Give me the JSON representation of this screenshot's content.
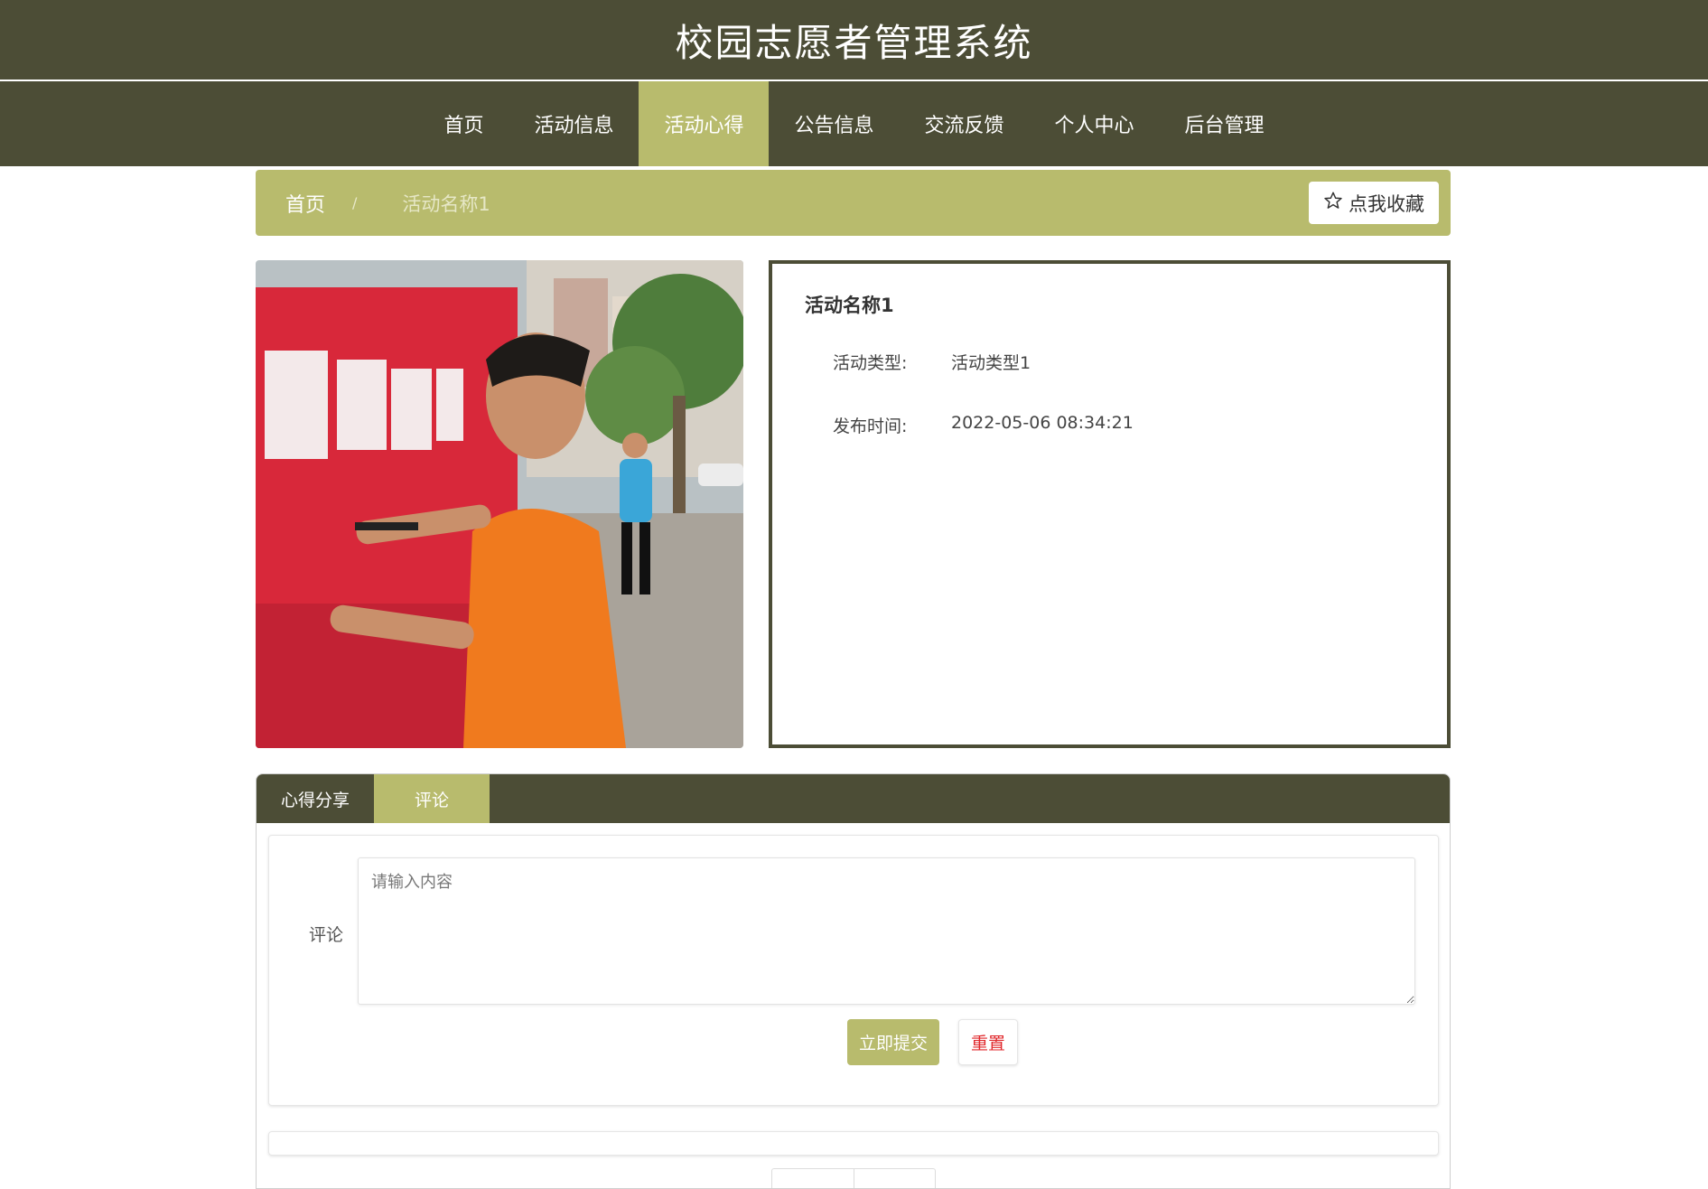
{
  "header": {
    "title": "校园志愿者管理系统"
  },
  "nav": {
    "items": [
      {
        "label": "首页"
      },
      {
        "label": "活动信息"
      },
      {
        "label": "活动心得"
      },
      {
        "label": "公告信息"
      },
      {
        "label": "交流反馈"
      },
      {
        "label": "个人中心"
      },
      {
        "label": "后台管理"
      }
    ],
    "active_index": 2
  },
  "breadcrumb": {
    "home": "首页",
    "separator": "/",
    "current": "活动名称1"
  },
  "favorite": {
    "label": "点我收藏",
    "icon": "star-outline-icon"
  },
  "detail": {
    "title": "活动名称1",
    "type_label": "活动类型:",
    "type_value": "活动类型1",
    "time_label": "发布时间:",
    "time_value": "2022-05-06 08:34:21"
  },
  "tabs": [
    {
      "label": "心得分享"
    },
    {
      "label": "评论"
    }
  ],
  "comment_form": {
    "label": "评论",
    "placeholder": "请输入内容",
    "value": "",
    "submit_label": "立即提交",
    "reset_label": "重置"
  },
  "colors": {
    "dark_olive": "#4c4d36",
    "accent_olive": "#b8bb6d",
    "reset_red": "#e0262a"
  }
}
